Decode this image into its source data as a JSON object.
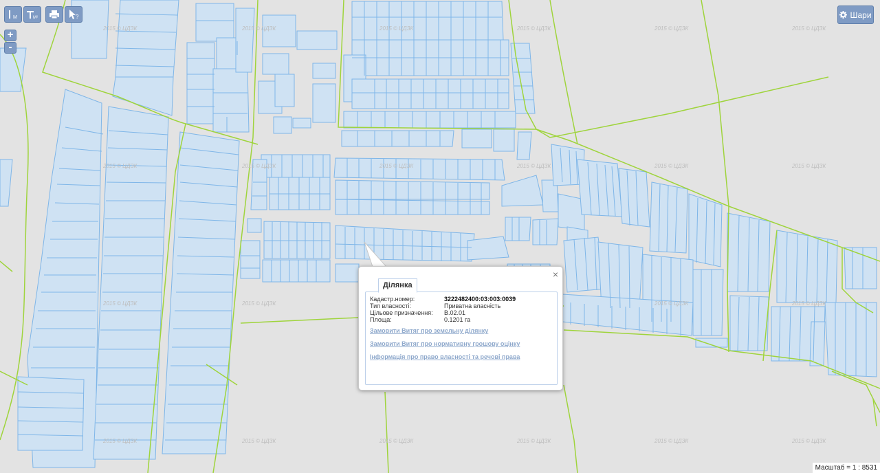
{
  "toolbar": {
    "measure_line_label": "М",
    "measure_area_label": "М²",
    "print_icon": "print-icon",
    "identify_icon": "identify-cursor-icon"
  },
  "zoom": {
    "in_label": "+",
    "out_label": "-"
  },
  "layers_button": {
    "label": "Шари",
    "icon": "gear-icon"
  },
  "watermark": "2015 © ЦДЗК",
  "popup": {
    "tab_label": "Ділянка",
    "close_label": "×",
    "attributes": [
      {
        "label": "Кадастр.номер:",
        "value": "3222482400:03:003:0039"
      },
      {
        "label": "Тип власності:",
        "value": "Приватна власність"
      },
      {
        "label": "Цільове призначення:",
        "value": "В.02.01"
      },
      {
        "label": "Площа:",
        "value": "0.1201 га"
      }
    ],
    "links": [
      "Замовити Витяг про земельну ділянку",
      "Замовити Витяг про нормативну грошову оцінку",
      "Інформація про право власності та речові права"
    ]
  },
  "scale": {
    "label": "Масштаб = 1 : 8531"
  },
  "colors": {
    "map_background": "#e3e3e3",
    "parcel_fill": "#cfe2f3",
    "parcel_stroke": "#7fb6e8",
    "boundary_line": "#9fd43c",
    "button": "#7f9bc4"
  }
}
